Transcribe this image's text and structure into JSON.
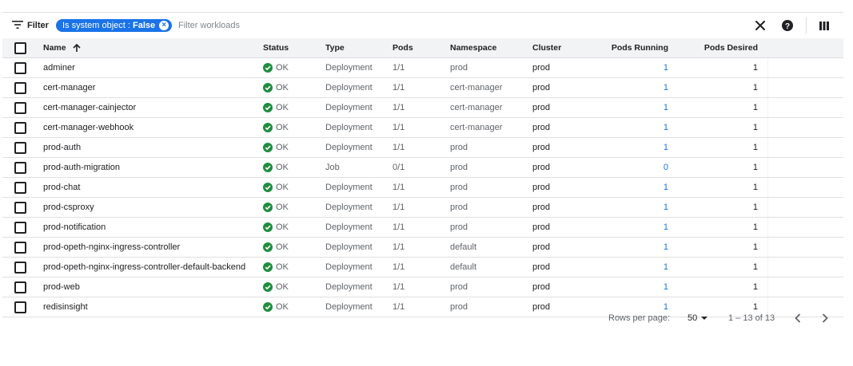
{
  "toolbar": {
    "filter_label": "Filter",
    "chip_key": "Is system object :",
    "chip_value": "False",
    "filter_placeholder": "Filter workloads"
  },
  "columns": {
    "name": "Name",
    "status": "Status",
    "type": "Type",
    "pods": "Pods",
    "namespace": "Namespace",
    "cluster": "Cluster",
    "pods_running": "Pods Running",
    "pods_desired": "Pods Desired"
  },
  "rows": [
    {
      "name": "adminer",
      "status": "OK",
      "type": "Deployment",
      "pods": "1/1",
      "namespace": "prod",
      "cluster": "prod",
      "pods_running": "1",
      "pods_desired": "1"
    },
    {
      "name": "cert-manager",
      "status": "OK",
      "type": "Deployment",
      "pods": "1/1",
      "namespace": "cert-manager",
      "cluster": "prod",
      "pods_running": "1",
      "pods_desired": "1"
    },
    {
      "name": "cert-manager-cainjector",
      "status": "OK",
      "type": "Deployment",
      "pods": "1/1",
      "namespace": "cert-manager",
      "cluster": "prod",
      "pods_running": "1",
      "pods_desired": "1"
    },
    {
      "name": "cert-manager-webhook",
      "status": "OK",
      "type": "Deployment",
      "pods": "1/1",
      "namespace": "cert-manager",
      "cluster": "prod",
      "pods_running": "1",
      "pods_desired": "1"
    },
    {
      "name": "prod-auth",
      "status": "OK",
      "type": "Deployment",
      "pods": "1/1",
      "namespace": "prod",
      "cluster": "prod",
      "pods_running": "1",
      "pods_desired": "1"
    },
    {
      "name": "prod-auth-migration",
      "status": "OK",
      "type": "Job",
      "pods": "0/1",
      "namespace": "prod",
      "cluster": "prod",
      "pods_running": "0",
      "pods_desired": "1"
    },
    {
      "name": "prod-chat",
      "status": "OK",
      "type": "Deployment",
      "pods": "1/1",
      "namespace": "prod",
      "cluster": "prod",
      "pods_running": "1",
      "pods_desired": "1"
    },
    {
      "name": "prod-csproxy",
      "status": "OK",
      "type": "Deployment",
      "pods": "1/1",
      "namespace": "prod",
      "cluster": "prod",
      "pods_running": "1",
      "pods_desired": "1"
    },
    {
      "name": "prod-notification",
      "status": "OK",
      "type": "Deployment",
      "pods": "1/1",
      "namespace": "prod",
      "cluster": "prod",
      "pods_running": "1",
      "pods_desired": "1"
    },
    {
      "name": "prod-opeth-nginx-ingress-controller",
      "status": "OK",
      "type": "Deployment",
      "pods": "1/1",
      "namespace": "default",
      "cluster": "prod",
      "pods_running": "1",
      "pods_desired": "1"
    },
    {
      "name": "prod-opeth-nginx-ingress-controller-default-backend",
      "status": "OK",
      "type": "Deployment",
      "pods": "1/1",
      "namespace": "default",
      "cluster": "prod",
      "pods_running": "1",
      "pods_desired": "1"
    },
    {
      "name": "prod-web",
      "status": "OK",
      "type": "Deployment",
      "pods": "1/1",
      "namespace": "prod",
      "cluster": "prod",
      "pods_running": "1",
      "pods_desired": "1"
    },
    {
      "name": "redisinsight",
      "status": "OK",
      "type": "Deployment",
      "pods": "1/1",
      "namespace": "prod",
      "cluster": "prod",
      "pods_running": "1",
      "pods_desired": "1"
    }
  ],
  "pagination": {
    "rows_per_page_label": "Rows per page:",
    "rows_per_page_value": "50",
    "range": "1 – 13 of 13"
  },
  "colors": {
    "accent": "#1a73e8",
    "ok_green": "#1e8e3e",
    "header_bg": "#f1f3f4"
  },
  "icons": {
    "filter": "filter-lines-icon",
    "chip_remove": "cancel-circle-icon",
    "clear": "close-icon",
    "help": "help-circle-icon",
    "columns": "column-display-icon",
    "sort": "arrow-up-icon",
    "status_ok": "check-circle-icon",
    "dropdown": "caret-down-icon",
    "prev": "chevron-left-icon",
    "next": "chevron-right-icon"
  }
}
